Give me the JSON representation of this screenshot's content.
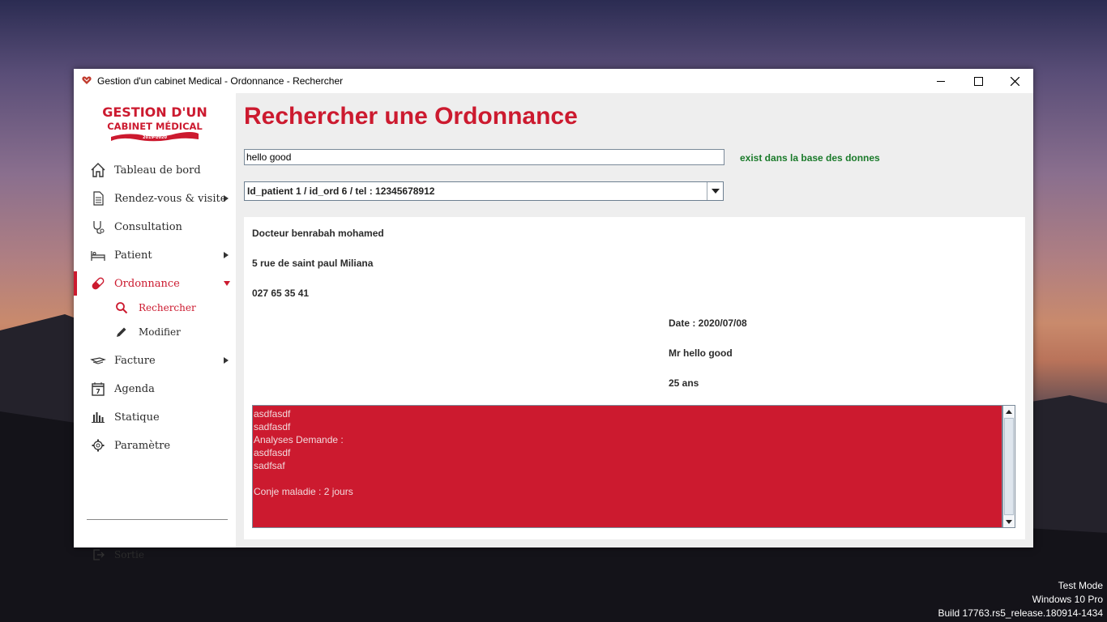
{
  "window": {
    "title": "Gestion d'un cabinet Medical - Ordonnance - Rechercher"
  },
  "logo": {
    "line1": "GESTION D'UN",
    "line2": "CABINET MÉDICAL",
    "line3": "2019-2020"
  },
  "sidebar": {
    "items": [
      {
        "label": "Tableau de bord",
        "icon": "home-icon"
      },
      {
        "label": "Rendez-vous & visite",
        "icon": "document-icon"
      },
      {
        "label": "Consultation",
        "icon": "stethoscope-icon"
      },
      {
        "label": "Patient",
        "icon": "bed-icon"
      },
      {
        "label": "Ordonnance",
        "icon": "pill-icon"
      },
      {
        "label": "Facture",
        "icon": "money-icon"
      },
      {
        "label": "Agenda",
        "icon": "calendar-icon"
      },
      {
        "label": "Statique",
        "icon": "bar-chart-icon"
      },
      {
        "label": "Paramètre",
        "icon": "gear-icon"
      }
    ],
    "subitems": [
      {
        "label": "Rechercher",
        "icon": "search-icon"
      },
      {
        "label": "Modifier",
        "icon": "pencil-icon"
      }
    ],
    "exit_label": "Sortie",
    "calendar_day": "7"
  },
  "main": {
    "title": "Rechercher une Ordonnance",
    "search_value": "hello good",
    "status_message": "exist dans la base des donnes",
    "combo_value": "Id_patient 1 / id_ord 6 / tel : 12345678912"
  },
  "ordonnance": {
    "doctor": "Docteur benrabah mohamed",
    "address": "5 rue de saint paul Miliana",
    "phone": "027 65 35 41",
    "date": "Date : 2020/07/08",
    "patient": "Mr hello good",
    "age": "25 ans",
    "content_lines": [
      "asdfasdf",
      "sadfasdf",
      "Analyses Demande :",
      "asdfasdf",
      "sadfsaf",
      "",
      "Conje maladie : 2 jours"
    ]
  },
  "os_watermark": {
    "line1": "Test Mode",
    "line2": "Windows 10 Pro",
    "line3": "Build 17763.rs5_release.180914-1434"
  },
  "colors": {
    "accent": "#cc1a2f",
    "success": "#1a7a2a"
  }
}
